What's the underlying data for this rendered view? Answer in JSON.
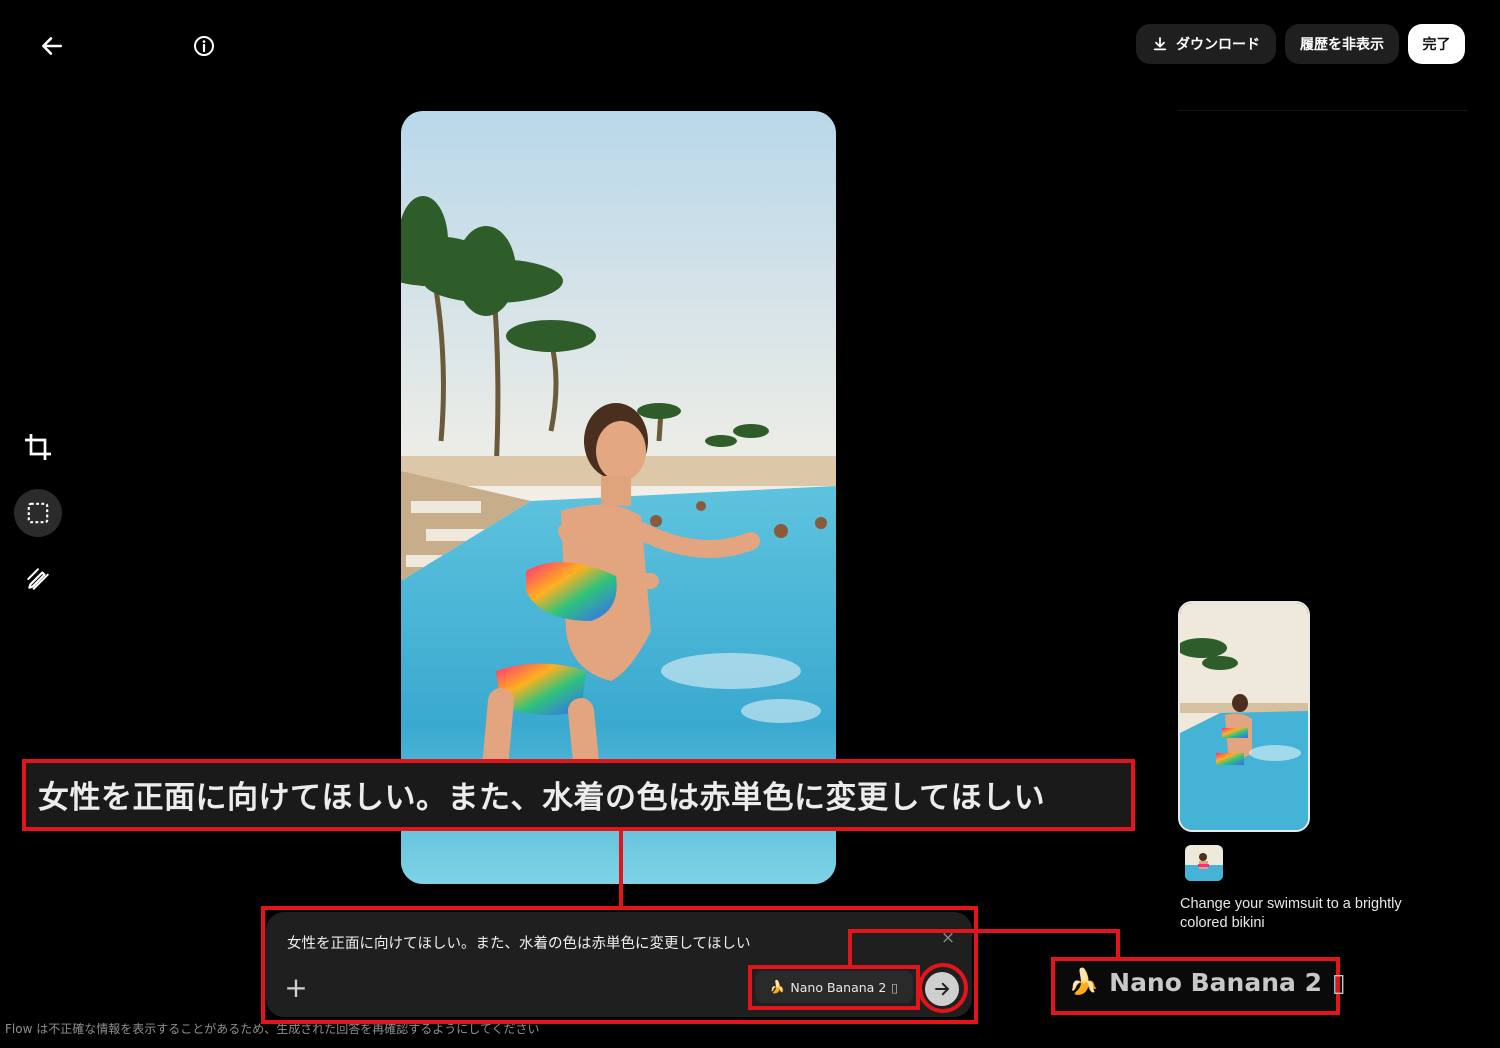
{
  "header": {
    "download_label": "ダウンロード",
    "hide_history_label": "履歴を非表示",
    "done_label": "完了"
  },
  "history": {
    "caption": "Change your swimsuit to a brightly colored bikini"
  },
  "prompt": {
    "text": "女性を正面に向けてほしい。また、水着の色は赤単色に変更してほしい",
    "close_glyph": "×",
    "add_glyph": "+",
    "model_name": "Nano Banana 2",
    "model_icon": "🍌",
    "model_extra_glyph": "▯"
  },
  "disclaimer": "Flow は不正確な情報を表示することがあるため、生成された回答を再確認するようにしてください",
  "annotations": {
    "prompt_zoom_text": "女性を正面に向けてほしい。また、水着の色は赤単色に変更してほしい",
    "model_zoom_text": "Nano Banana 2",
    "model_zoom_icon": "🍌",
    "model_zoom_extra_glyph": "▯",
    "highlight_color": "#e1151a"
  },
  "icons": {
    "back": "arrow-left-icon",
    "info": "info-icon",
    "download": "download-icon",
    "crop": "crop-icon",
    "select": "selection-icon",
    "edit": "magic-pen-icon",
    "send": "arrow-right-icon"
  }
}
